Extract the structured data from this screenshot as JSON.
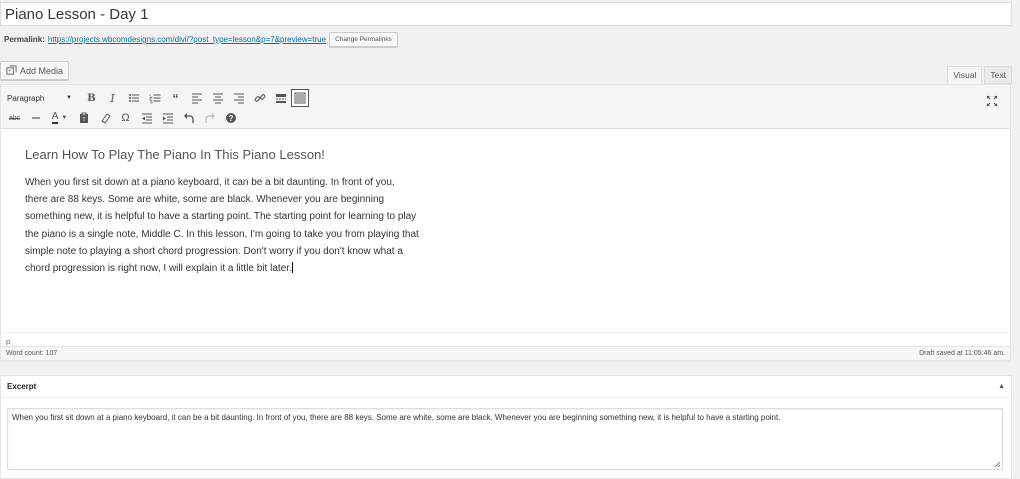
{
  "post": {
    "title": "Piano Lesson - Day 1"
  },
  "permalink": {
    "label": "Permalink:",
    "url": "https://projects.wbcomdesigns.com/divi/?post_type=lesson&p=7&preview=true",
    "change_button": "Change Permalinks"
  },
  "media": {
    "add_label": "Add Media"
  },
  "tabs": {
    "visual": "Visual",
    "text": "Text"
  },
  "toolbar": {
    "format_value": "Paragraph",
    "row1_icons": [
      "bold-icon",
      "italic-icon",
      "bullet-list-icon",
      "numbered-list-icon",
      "blockquote-icon",
      "align-left-icon",
      "align-center-icon",
      "align-right-icon",
      "link-icon",
      "read-more-icon",
      "toolbar-toggle-icon"
    ],
    "row2_icons": [
      "strikethrough-icon",
      "horizontal-line-icon",
      "text-color-icon",
      "paste-text-icon",
      "clear-formatting-icon",
      "special-character-icon",
      "outdent-icon",
      "indent-icon",
      "undo-icon",
      "redo-icon",
      "help-icon"
    ],
    "expand_icon": "fullscreen-icon"
  },
  "content": {
    "heading": "Learn How To Play The Piano In This Piano Lesson!",
    "paragraph": "When you first sit down at a piano keyboard, it can be a bit daunting. In front of you, there are 88 keys. Some are white, some are black. Whenever you are beginning something new, it is helpful to have a starting point. The starting point for learning to play the piano is a single note, Middle C. In this lesson, I'm going to take you from playing that simple note to playing a short chord progression. Don't worry if you don't know what a chord progression is right now, I will explain it a little bit later."
  },
  "path": "p",
  "status": {
    "word_count": "Word count: 107",
    "draft_saved": "Draft saved at 11:05:46 am."
  },
  "excerpt": {
    "title": "Excerpt",
    "toggle": "▲",
    "text": "When you first sit down at a piano keyboard, it can be a bit daunting. In front of you, there are 88 keys. Some are white, some are black. Whenever you are beginning something new, it is helpful to have a starting point."
  },
  "colors": {
    "link": "#0073aa",
    "border": "#dddddd",
    "background": "#f1f1f1"
  }
}
